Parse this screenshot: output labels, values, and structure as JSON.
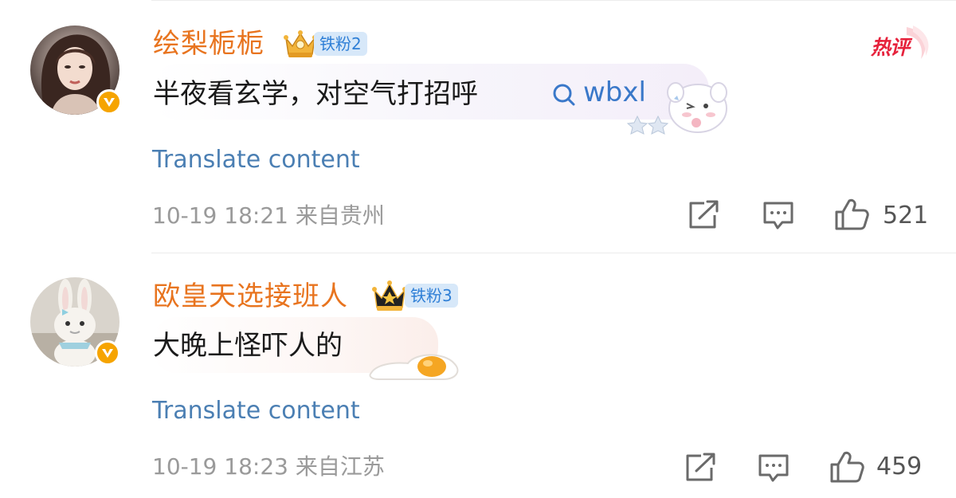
{
  "comments": [
    {
      "username": "绘梨栀栀",
      "fan_badge": "铁粉2",
      "hot_label": "热评",
      "text": "半夜看玄学，对空气打招呼",
      "search_term": "wbxl",
      "translate": "Translate content",
      "meta": "10-19 18:21 来自贵州",
      "likes": "521"
    },
    {
      "username": "欧皇天选接班人",
      "fan_badge": "铁粉3",
      "text": "大晚上怪吓人的",
      "translate": "Translate content",
      "meta": "10-19 18:23 来自江苏",
      "likes": "459"
    }
  ],
  "colors": {
    "username": "#e8741f",
    "link": "#3a78c9",
    "translate": "#4b7fb3",
    "meta": "#9a9a9a",
    "hot": "#e6223c",
    "fan_badge_bg": "#d7e8f9"
  },
  "icons": [
    "verified-badge-icon",
    "crown-icon",
    "search-icon",
    "share-icon",
    "comment-icon",
    "like-icon",
    "sticker-icon"
  ]
}
